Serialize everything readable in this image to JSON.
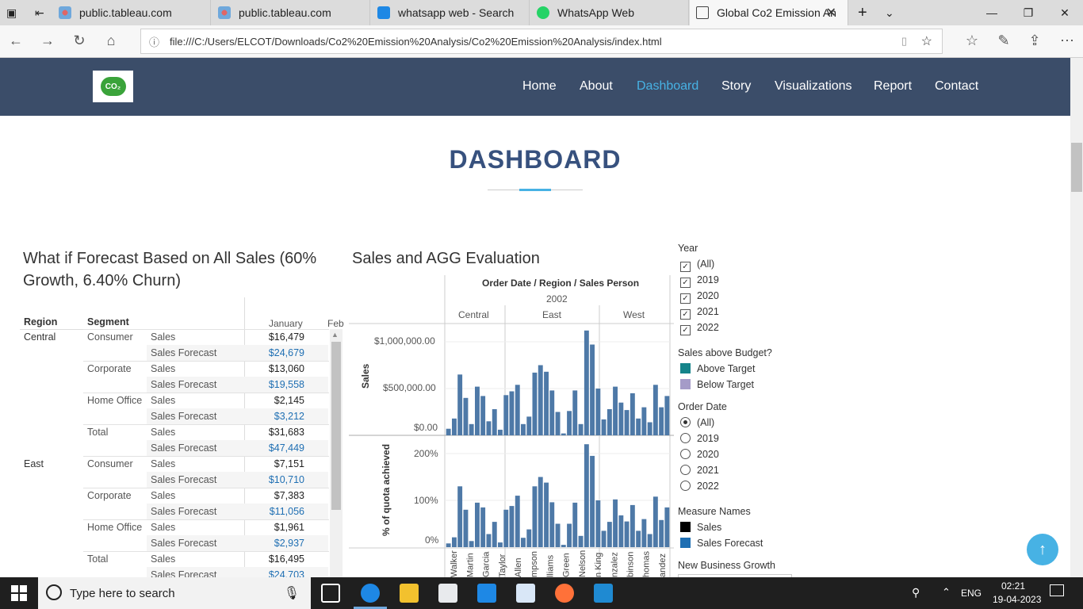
{
  "browser": {
    "tabs": [
      {
        "title": "public.tableau.com"
      },
      {
        "title": "public.tableau.com"
      },
      {
        "title": "whatsapp web - Search"
      },
      {
        "title": "WhatsApp Web"
      },
      {
        "title": "Global Co2 Emission An"
      }
    ],
    "url": "file:///C:/Users/ELCOT/Downloads/Co2%20Emission%20Analysis/Co2%20Emission%20Analysis/index.html"
  },
  "site": {
    "logo_text": "CO₂",
    "nav": [
      "Home",
      "About",
      "Dashboard",
      "Story",
      "Visualizations",
      "Report",
      "Contact"
    ],
    "active_nav": "Dashboard",
    "page_title": "DASHBOARD"
  },
  "forecast": {
    "title": "What if Forecast Based on All Sales (60% Growth, 6.40% Churn)",
    "headers": {
      "region": "Region",
      "segment": "Segment",
      "col1": "January",
      "col2": "Feb"
    },
    "rows": [
      {
        "region": "Central",
        "segment": "Consumer",
        "measure": "Sales",
        "value": "$16,479"
      },
      {
        "region": "",
        "segment": "",
        "measure": "Sales Forecast",
        "value": "$24,679"
      },
      {
        "region": "",
        "segment": "Corporate",
        "measure": "Sales",
        "value": "$13,060"
      },
      {
        "region": "",
        "segment": "",
        "measure": "Sales Forecast",
        "value": "$19,558"
      },
      {
        "region": "",
        "segment": "Home Office",
        "measure": "Sales",
        "value": "$2,145"
      },
      {
        "region": "",
        "segment": "",
        "measure": "Sales Forecast",
        "value": "$3,212"
      },
      {
        "region": "",
        "segment": "Total",
        "measure": "Sales",
        "value": "$31,683"
      },
      {
        "region": "",
        "segment": "",
        "measure": "Sales Forecast",
        "value": "$47,449"
      },
      {
        "region": "East",
        "segment": "Consumer",
        "measure": "Sales",
        "value": "$7,151"
      },
      {
        "region": "",
        "segment": "",
        "measure": "Sales Forecast",
        "value": "$10,710"
      },
      {
        "region": "",
        "segment": "Corporate",
        "measure": "Sales",
        "value": "$7,383"
      },
      {
        "region": "",
        "segment": "",
        "measure": "Sales Forecast",
        "value": "$11,056"
      },
      {
        "region": "",
        "segment": "Home Office",
        "measure": "Sales",
        "value": "$1,961"
      },
      {
        "region": "",
        "segment": "",
        "measure": "Sales Forecast",
        "value": "$2,937"
      },
      {
        "region": "",
        "segment": "Total",
        "measure": "Sales",
        "value": "$16,495"
      },
      {
        "region": "",
        "segment": "",
        "measure": "Sales Forecast",
        "value": "$24,703"
      }
    ]
  },
  "evaluation": {
    "title": "Sales and AGG Evaluation",
    "header": "Order Date / Region / Sales Person",
    "year": "2002",
    "regions": [
      "Central",
      "East",
      "West"
    ],
    "y1_label": "Sales",
    "y1_ticks": [
      "$1,000,000.00",
      "$500,000.00",
      "$0.00"
    ],
    "y2_label": "% of quota achieved",
    "y2_ticks": [
      "200%",
      "100%",
      "0%"
    ],
    "people": [
      "Walker",
      "Martin",
      "Garcia",
      "Taylor",
      "Allen",
      "mpson",
      "lliams",
      "Green",
      "Nelson",
      "n King",
      "nzalez",
      "binson",
      "homas",
      "andez"
    ],
    "sales_bars": [
      7,
      18,
      65,
      40,
      12,
      52,
      42,
      15,
      28,
      6,
      43,
      47,
      54,
      12,
      20,
      67,
      75,
      68,
      48,
      25,
      2,
      26,
      48,
      12,
      112,
      97,
      50,
      17,
      28,
      52,
      35,
      27,
      45,
      18,
      30,
      14,
      54,
      30,
      42
    ],
    "quota_bars": [
      8,
      21,
      130,
      80,
      13,
      95,
      85,
      28,
      54,
      10,
      80,
      88,
      110,
      20,
      38,
      130,
      150,
      138,
      96,
      50,
      5,
      50,
      95,
      24,
      220,
      195,
      100,
      35,
      54,
      102,
      68,
      55,
      90,
      35,
      60,
      28,
      108,
      58,
      85
    ]
  },
  "filters": {
    "year": {
      "title": "Year",
      "items": [
        "(All)",
        "2019",
        "2020",
        "2021",
        "2022"
      ]
    },
    "budget": {
      "title": "Sales above Budget?",
      "items": [
        {
          "label": "Above Target",
          "color": "#15848a"
        },
        {
          "label": "Below Target",
          "color": "#a59bc8"
        }
      ]
    },
    "order_date": {
      "title": "Order Date",
      "items": [
        "(All)",
        "2019",
        "2020",
        "2021",
        "2022"
      ]
    },
    "measure": {
      "title": "Measure Names",
      "items": [
        {
          "label": "Sales",
          "color": "#000000"
        },
        {
          "label": "Sales Forecast",
          "color": "#1f6fb3"
        }
      ]
    },
    "growth": {
      "title": "New Business Growth"
    }
  },
  "taskbar": {
    "search_placeholder": "Type here to search",
    "lang": "ENG",
    "time": "02:21",
    "date": "19-04-2023"
  },
  "colors": {
    "header_bg": "#3b4d69",
    "accent": "#47b2e4",
    "bar": "#4e79a7"
  }
}
